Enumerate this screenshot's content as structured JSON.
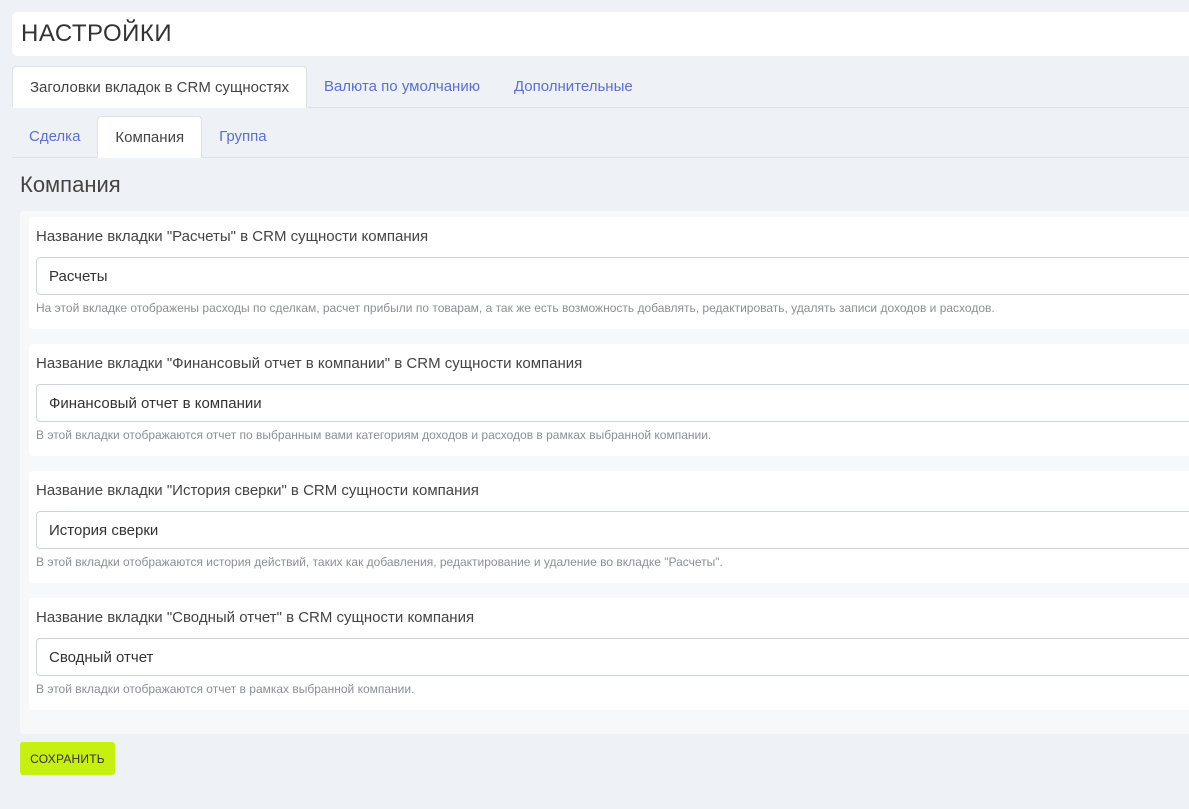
{
  "page": {
    "title": "НАСТРОЙКИ"
  },
  "main_tabs": [
    {
      "label": "Заголовки вкладок в CRM сущностях",
      "active": true
    },
    {
      "label": "Валюта по умолчанию",
      "active": false
    },
    {
      "label": "Дополнительные",
      "active": false
    }
  ],
  "sub_tabs": [
    {
      "label": "Сделка",
      "active": false
    },
    {
      "label": "Компания",
      "active": true
    },
    {
      "label": "Группа",
      "active": false
    }
  ],
  "section": {
    "heading": "Компания"
  },
  "fields": [
    {
      "label": "Название вкладки \"Расчеты\" в CRM сущности компания",
      "value": "Расчеты",
      "help": "На этой вкладке отображены расходы по сделкам, расчет прибыли по товарам, а так же есть возможность добавлять, редактировать, удалять записи доходов и расходов."
    },
    {
      "label": "Название вкладки \"Финансовый отчет в компании\" в CRM сущности компания",
      "value": "Финансовый отчет в компании",
      "help": "В этой вкладки отображаются отчет по выбранным вами категориям доходов и расходов в рамках выбранной компании."
    },
    {
      "label": "Название вкладки \"История сверки\" в CRM сущности компания",
      "value": "История сверки",
      "help": "В этой вкладки отображаются история действий, таких как добавления, редактирование и удаление во вкладке \"Расчеты\"."
    },
    {
      "label": "Название вкладки \"Сводный отчет\" в CRM сущности компания",
      "value": "Сводный отчет",
      "help": "В этой вкладки отображаются отчет в рамках выбранной компании."
    }
  ],
  "actions": {
    "save_label": "СОХРАНИТЬ"
  },
  "colors": {
    "accent_link": "#5b6fd6",
    "save_button": "#c6ef12",
    "page_background": "#eef1f5"
  }
}
